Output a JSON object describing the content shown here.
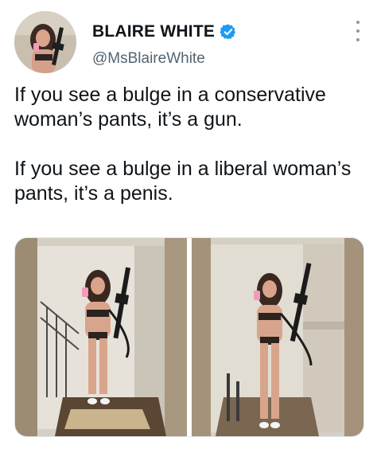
{
  "author": {
    "display_name": "BLAIRE WHITE",
    "handle": "@MsBlaireWhite",
    "verified": true,
    "verified_color": "#1d9bf0"
  },
  "tweet": {
    "paragraphs": [
      "If you see a bulge in a conservative woman’s pants, it’s a gun.",
      "If you see a bulge in a liberal woman’s pants, it’s a penis."
    ]
  },
  "icons": {
    "more": "more-options-icon",
    "verified": "verified-badge-icon"
  },
  "media": {
    "count": 2
  }
}
